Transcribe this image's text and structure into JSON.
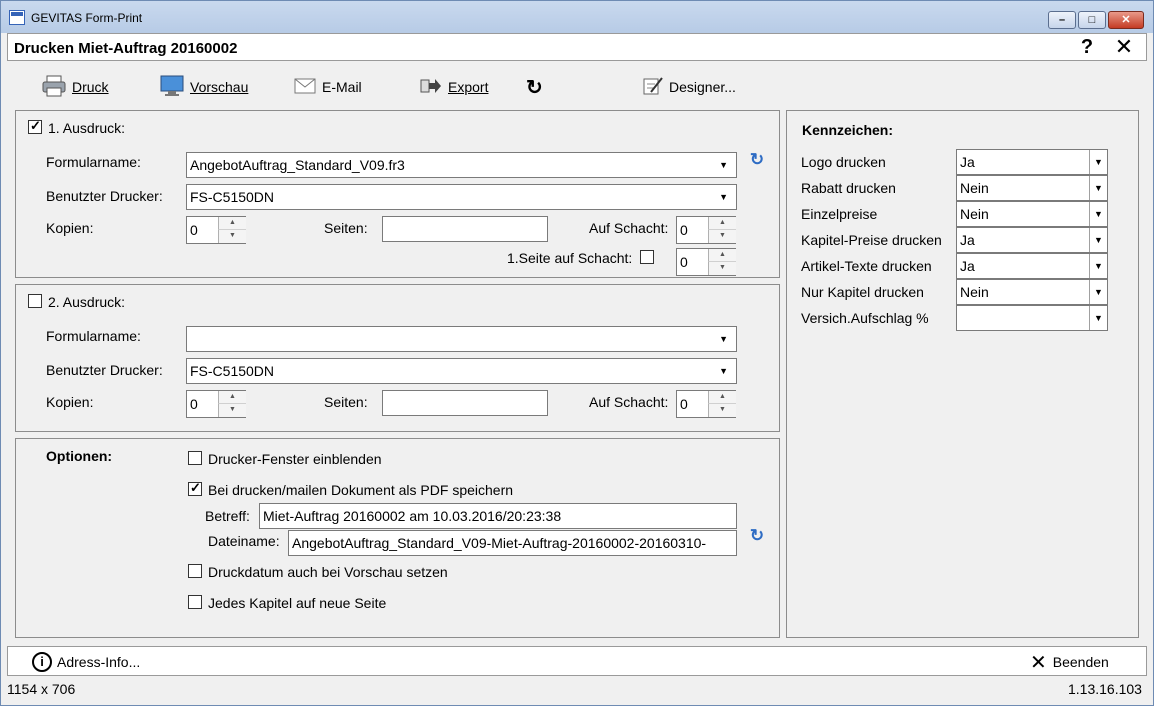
{
  "window": {
    "title": "GEVITAS Form-Print"
  },
  "header": {
    "title": "Drucken  Miet-Auftrag  20160002",
    "help": "?",
    "close": "✕"
  },
  "toolbar": {
    "druck": "Druck",
    "vorschau": "Vorschau",
    "email": "E-Mail",
    "export": "Export",
    "designer": "Designer..."
  },
  "ausdruck1": {
    "label": "1. Ausdruck:",
    "checked": true,
    "formularname_label": "Formularname:",
    "formularname_value": "AngebotAuftrag_Standard_V09.fr3",
    "drucker_label": "Benutzter Drucker:",
    "drucker_value": "FS-C5150DN",
    "kopien_label": "Kopien:",
    "kopien_value": "0",
    "seiten_label": "Seiten:",
    "seiten_value": "",
    "schacht_label": "Auf Schacht:",
    "schacht_value": "0",
    "seite1_label": "1.Seite auf Schacht:",
    "seite1_value": "0"
  },
  "ausdruck2": {
    "label": "2. Ausdruck:",
    "checked": false,
    "formularname_label": "Formularname:",
    "formularname_value": "",
    "drucker_label": "Benutzter Drucker:",
    "drucker_value": "FS-C5150DN",
    "kopien_label": "Kopien:",
    "kopien_value": "0",
    "seiten_label": "Seiten:",
    "seiten_value": "",
    "schacht_label": "Auf Schacht:",
    "schacht_value": "0"
  },
  "optionen": {
    "title": "Optionen:",
    "drucker_fenster": "Drucker-Fenster einblenden",
    "pdf_speichern": "Bei drucken/mailen Dokument als PDF speichern",
    "betreff_label": "Betreff:",
    "betreff_value": "Miet-Auftrag 20160002 am 10.03.2016/20:23:38",
    "dateiname_label": "Dateiname:",
    "dateiname_value": "AngebotAuftrag_Standard_V09-Miet-Auftrag-20160002-20160310-",
    "druckdatum": "Druckdatum auch bei Vorschau setzen",
    "kapitel_seite": "Jedes Kapitel auf neue Seite"
  },
  "kennzeichen": {
    "title": "Kennzeichen:",
    "rows": [
      {
        "label": "Logo drucken",
        "value": "Ja"
      },
      {
        "label": "Rabatt drucken",
        "value": "Nein"
      },
      {
        "label": "Einzelpreise",
        "value": "Nein"
      },
      {
        "label": "Kapitel-Preise drucken",
        "value": "Ja"
      },
      {
        "label": "Artikel-Texte drucken",
        "value": "Ja"
      },
      {
        "label": "Nur Kapitel drucken",
        "value": "Nein"
      },
      {
        "label": "Versich.Aufschlag %",
        "value": ""
      }
    ]
  },
  "footer": {
    "adress_info": "Adress-Info...",
    "beenden": "Beenden"
  },
  "status": {
    "size": "1154 x 706",
    "version": "1.13.16.103"
  }
}
